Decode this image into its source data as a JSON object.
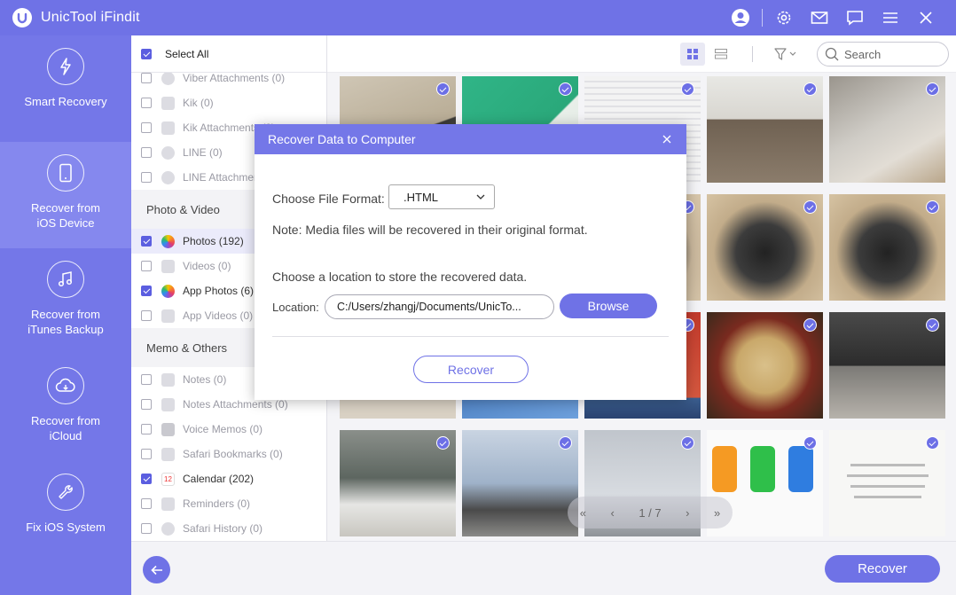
{
  "app": {
    "title": "UnicTool iFindit"
  },
  "titlebar_icons": [
    "user-icon",
    "gear-icon",
    "mail-icon",
    "feedback-icon",
    "menu-icon",
    "close-icon"
  ],
  "nav": [
    {
      "label": "Smart Recovery",
      "icon": "lightning-icon",
      "active": false
    },
    {
      "label": "Recover from\niOS Device",
      "icon": "phone-icon",
      "active": true
    },
    {
      "label": "Recover from\niTunes Backup",
      "icon": "music-icon",
      "active": false
    },
    {
      "label": "Recover from\niCloud",
      "icon": "cloud-icon",
      "active": false
    },
    {
      "label": "Fix iOS System",
      "icon": "wrench-icon",
      "active": false
    }
  ],
  "categories": {
    "select_all": "Select All",
    "top_rows": [
      {
        "label": "Viber Attachments (0)",
        "checked": false
      },
      {
        "label": "Kik (0)",
        "checked": false
      },
      {
        "label": "Kik Attachments (0)",
        "checked": false
      },
      {
        "label": "LINE (0)",
        "checked": false
      },
      {
        "label": "LINE Attachments (0)",
        "checked": false
      }
    ],
    "photo_section": "Photo & Video",
    "photo_rows": [
      {
        "label": "Photos (192)",
        "checked": true,
        "selected": true
      },
      {
        "label": "Videos (0)",
        "checked": false
      },
      {
        "label": "App Photos (6)",
        "checked": true
      },
      {
        "label": "App Videos (0)",
        "checked": false
      }
    ],
    "memo_section": "Memo & Others",
    "memo_rows": [
      {
        "label": "Notes (0)",
        "checked": false
      },
      {
        "label": "Notes Attachments (0)",
        "checked": false
      },
      {
        "label": "Voice Memos (0)",
        "checked": false
      },
      {
        "label": "Safari Bookmarks (0)",
        "checked": false
      },
      {
        "label": "Calendar (202)",
        "checked": true
      },
      {
        "label": "Reminders (0)",
        "checked": false
      },
      {
        "label": "Safari History (0)",
        "checked": false
      }
    ]
  },
  "toolbar": {
    "search_placeholder": "Search"
  },
  "pager": {
    "text": "1 / 7"
  },
  "bottom": {
    "recover_label": "Recover"
  },
  "modal": {
    "title": "Recover Data to Computer",
    "format_label": "Choose File Format:",
    "format_value": ".HTML",
    "note": "Note: Media files will be recovered in their original format.",
    "location_prompt": "Choose a location to store the recovered data.",
    "location_label": "Location:",
    "location_value": "C:/Users/zhangj/Documents/UnicTo...",
    "browse_label": "Browse",
    "recover_label": "Recover"
  },
  "colors": {
    "accent": "#6f72e6",
    "nav_bg": "#7477e8",
    "nav_active": "#8588ee"
  }
}
